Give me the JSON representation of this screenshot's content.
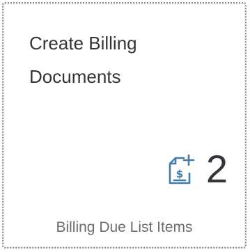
{
  "tile": {
    "title_line1": "Create Billing",
    "title_line2": "Documents",
    "kpi_value": "2",
    "kpi_icon": "add-invoice-icon",
    "footer": "Billing Due List Items",
    "accent_color": "#427cac"
  }
}
